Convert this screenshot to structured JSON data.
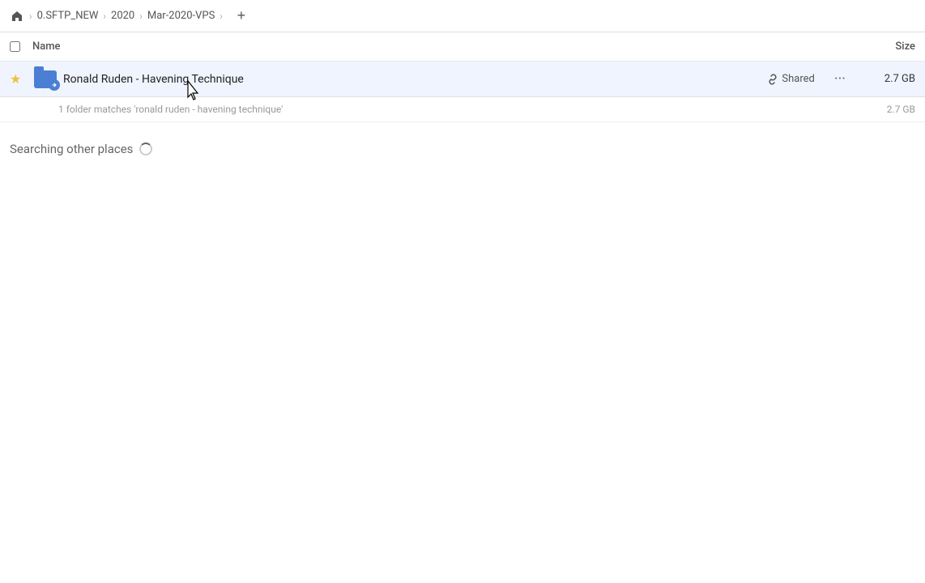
{
  "header": {
    "home_icon": "🏠",
    "breadcrumbs": [
      {
        "label": "0.SFTP_NEW"
      },
      {
        "label": "2020"
      },
      {
        "label": "Mar-2020-VPS"
      }
    ],
    "add_tab_label": "+"
  },
  "columns": {
    "name_label": "Name",
    "size_label": "Size"
  },
  "file_row": {
    "name": "Ronald Ruden - Havening Technique",
    "shared_label": "Shared",
    "size": "2.7 GB",
    "more_icon": "···"
  },
  "match_info": {
    "text": "1 folder matches 'ronald ruden - havening technique'",
    "size": "2.7 GB"
  },
  "searching_section": {
    "title": "Searching other places"
  }
}
